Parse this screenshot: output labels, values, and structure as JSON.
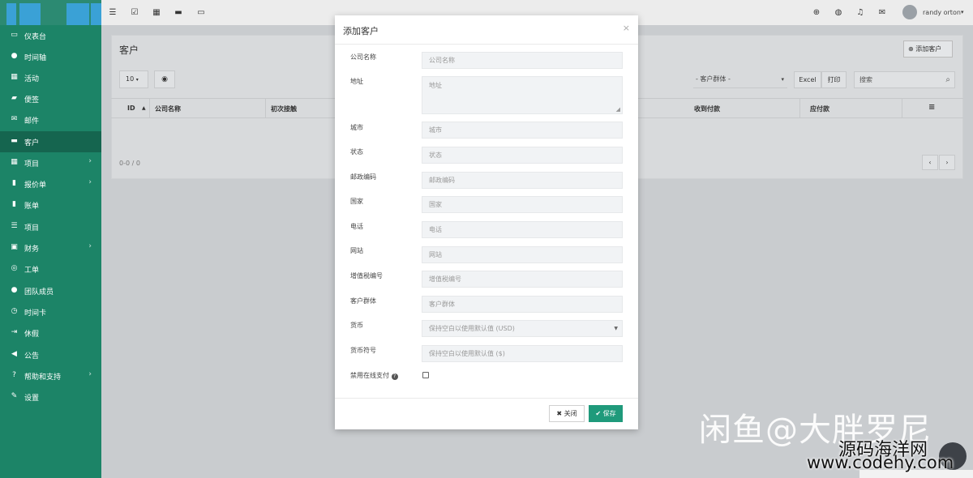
{
  "topbar": {
    "icons": [
      "list-icon",
      "checkbox-icon",
      "grid-icon",
      "briefcase-icon",
      "monitor-icon"
    ],
    "right_icons": [
      "plus-circle-icon",
      "globe-icon",
      "bell-icon",
      "mail-icon"
    ],
    "user_name": "randy orton",
    "user_caret": "▾"
  },
  "sidebar": {
    "items": [
      {
        "label": "仪表台",
        "icon": "monitor-icon",
        "glyph": "▭"
      },
      {
        "label": "时间轴",
        "icon": "comments-icon",
        "glyph": "●"
      },
      {
        "label": "活动",
        "icon": "calendar-icon",
        "glyph": "▦"
      },
      {
        "label": "便签",
        "icon": "book-icon",
        "glyph": "▰"
      },
      {
        "label": "邮件",
        "icon": "envelope-icon",
        "glyph": "✉"
      },
      {
        "label": "客户",
        "icon": "briefcase-icon",
        "glyph": "▬",
        "active": true
      },
      {
        "label": "项目",
        "icon": "th-large-icon",
        "glyph": "▦",
        "arrow": "›"
      },
      {
        "label": "报价单",
        "icon": "file-icon",
        "glyph": "▮",
        "arrow": "›"
      },
      {
        "label": "账单",
        "icon": "file-text-icon",
        "glyph": "▮"
      },
      {
        "label": "项目",
        "icon": "list-icon",
        "glyph": "☰"
      },
      {
        "label": "财务",
        "icon": "money-icon",
        "glyph": "▣",
        "arrow": "›"
      },
      {
        "label": "工单",
        "icon": "life-ring-icon",
        "glyph": "◎"
      },
      {
        "label": "团队成员",
        "icon": "user-icon",
        "glyph": "●"
      },
      {
        "label": "时间卡",
        "icon": "clock-icon",
        "glyph": "◷"
      },
      {
        "label": "休假",
        "icon": "sign-out-icon",
        "glyph": "⇥"
      },
      {
        "label": "公告",
        "icon": "bullhorn-icon",
        "glyph": "◀"
      },
      {
        "label": "帮助和支持",
        "icon": "question-circle-icon",
        "glyph": "?",
        "arrow": "›"
      },
      {
        "label": "设置",
        "icon": "wrench-icon",
        "glyph": "✎"
      }
    ]
  },
  "page": {
    "title": "客户",
    "add_button": "添加客户",
    "page_size": "10",
    "group_filter": "- 客户群体 -",
    "excel": "Excel",
    "print": "打印",
    "search_placeholder": "搜索",
    "columns": [
      "ID",
      "公司名称",
      "初次接触",
      "收到付款",
      "应付款"
    ],
    "menu_icon": "≡",
    "count": "0-0 / 0",
    "prev": "‹",
    "next": "›"
  },
  "modal": {
    "title": "添加客户",
    "close_x": "×",
    "fields": [
      {
        "label": "公司名称",
        "placeholder": "公司名称"
      },
      {
        "label": "地址",
        "placeholder": "地址"
      },
      {
        "label": "城市",
        "placeholder": "城市"
      },
      {
        "label": "状态",
        "placeholder": "状态"
      },
      {
        "label": "邮政编码",
        "placeholder": "邮政编码"
      },
      {
        "label": "国家",
        "placeholder": "国家"
      },
      {
        "label": "电话",
        "placeholder": "电话"
      },
      {
        "label": "网站",
        "placeholder": "网站"
      },
      {
        "label": "增值税编号",
        "placeholder": "增值税编号"
      },
      {
        "label": "客户群体",
        "placeholder": "客户群体"
      },
      {
        "label": "货币",
        "placeholder": "保持空白以使用默认值 (USD)"
      },
      {
        "label": "货币符号",
        "placeholder": "保持空白以使用默认值 ($)"
      }
    ],
    "disable_online_payment_label": "禁用在线支付",
    "disable_online_payment_checked": false,
    "close_button": "关闭",
    "save_button": "保存",
    "accent": "#1f9a7b"
  },
  "watermark": {
    "line1": "闲鱼@大胖罗尼",
    "line2": "源码海洋网",
    "line3": "www.codehy.com"
  }
}
